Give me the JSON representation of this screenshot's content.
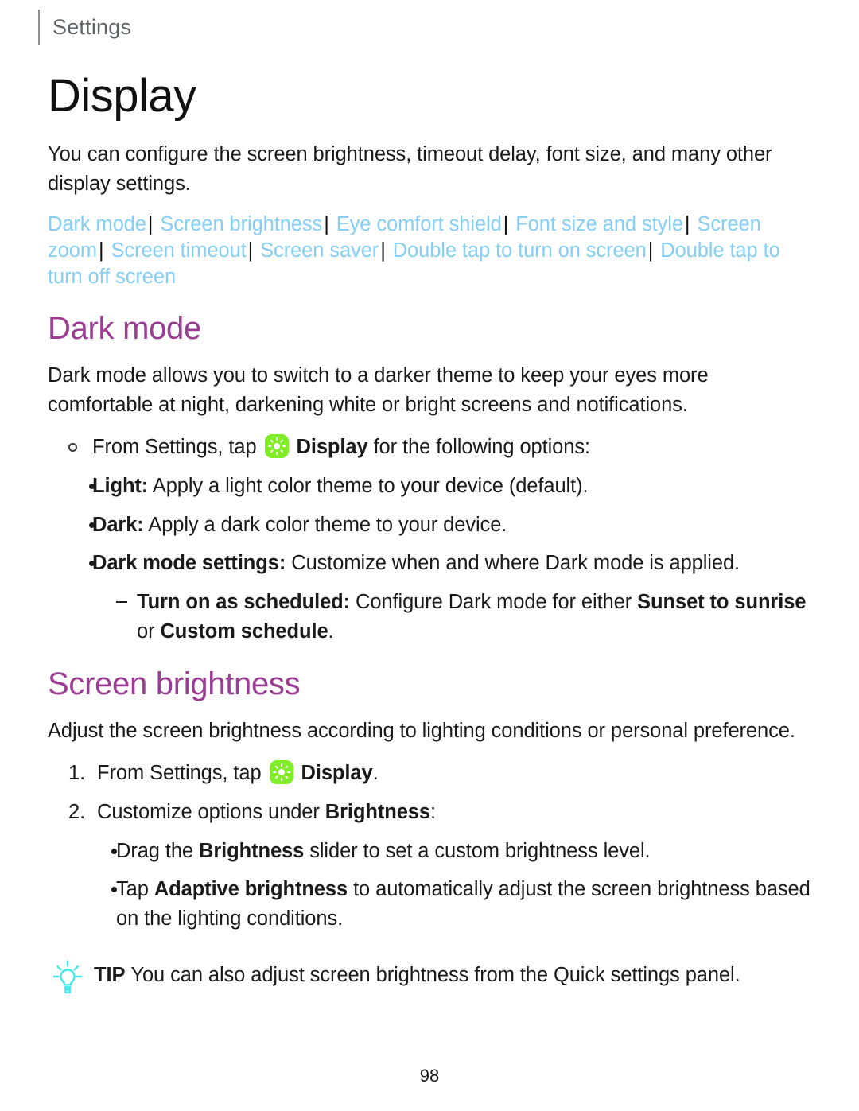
{
  "breadcrumb": {
    "label": "Settings"
  },
  "page_title": "Display",
  "intro": "You can configure the screen brightness, timeout delay, font size, and many other display settings.",
  "nav_links": [
    "Dark mode",
    "Screen brightness",
    "Eye comfort shield",
    "Font size and style",
    "Screen zoom",
    "Screen timeout",
    "Screen saver",
    "Double tap to turn on screen",
    "Double tap to turn off screen"
  ],
  "nav_separator": "|",
  "sections": [
    {
      "heading": "Dark mode",
      "body": "Dark mode allows you to switch to a darker theme to keep your eyes more comfortable at night, darkening white or bright screens and notifications.",
      "lead_in": {
        "before_icon": "From Settings, tap",
        "icon": "display-brightness-icon",
        "bold_after_icon": "Display",
        "after": "for the following options:"
      },
      "options": [
        {
          "term": "Light:",
          "desc": "Apply a light color theme to your device (default)."
        },
        {
          "term": "Dark:",
          "desc": "Apply a dark color theme to your device."
        },
        {
          "term": "Dark mode settings:",
          "desc": "Customize when and where Dark mode is applied."
        }
      ],
      "sub_option": {
        "term": "Turn on as scheduled:",
        "desc_part1": "Configure Dark mode for either",
        "bold1": "Sunset to sunrise",
        "conjunction": "or",
        "bold2": "Custom schedule",
        "trailing": "."
      }
    },
    {
      "heading": "Screen brightness",
      "body": "Adjust the screen brightness according to lighting conditions or personal preference.",
      "steps": [
        {
          "number": "1.",
          "before_icon": "From Settings, tap",
          "icon": "display-brightness-icon",
          "bold_after_icon": "Display",
          "after": "."
        },
        {
          "number": "2.",
          "text_before": "Customize options under",
          "bold": "Brightness",
          "text_after": ":"
        }
      ],
      "step_details": [
        {
          "before": "Drag the",
          "bold": "Brightness",
          "after": "slider to set a custom brightness level."
        },
        {
          "before": "Tap",
          "bold": "Adaptive brightness",
          "after": "to automatically adjust the screen brightness based on the lighting conditions."
        }
      ]
    }
  ],
  "tip": {
    "icon": "lightbulb-icon",
    "label": "TIP",
    "text": "You can also adjust screen brightness from the Quick settings panel."
  },
  "footer": {
    "page_number": "98"
  },
  "colors": {
    "link": "#85CEF5",
    "heading_accent": "#9B3D94",
    "icon_green": "#80ED26",
    "tip_cyan": "#3FE9EC",
    "breadcrumb_gray": "#5d6368"
  }
}
